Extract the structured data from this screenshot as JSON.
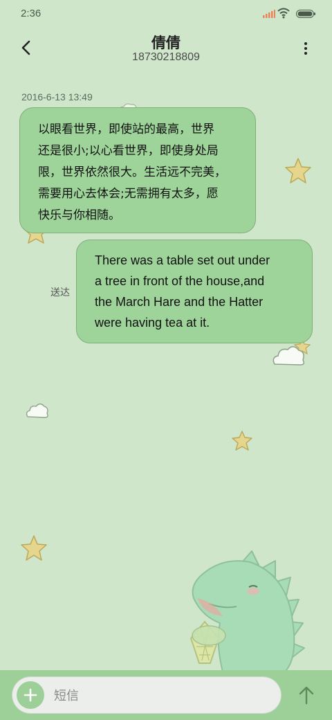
{
  "status": {
    "time": "2:36"
  },
  "header": {
    "name": "倩倩",
    "number": "18730218809"
  },
  "conversation": {
    "timestamp": "2016-6-13 13:49",
    "received": {
      "lines": [
        "以眼看世界，即使站的最高，世界",
        "还是很小;以心看世界，即使身处局",
        "限，世界依然很大。生活远不完美，",
        "需要用心去体会;无需拥有太多，愿",
        "快乐与你相随。"
      ]
    },
    "sent": {
      "lines": [
        "There was a table set out under",
        "a tree in front of the house,and",
        "the March Hare and the Hatter",
        "were having tea at it."
      ],
      "status": "送达"
    }
  },
  "composer": {
    "placeholder": "短信"
  },
  "colors": {
    "background": "#cfe6cb",
    "bubble": "#9ed49a",
    "bottom_bar": "#9dd099"
  },
  "icons": [
    "back-arrow-icon",
    "more-vertical-icon",
    "signal-icon",
    "wifi-icon",
    "battery-icon",
    "plus-icon",
    "send-arrow-icon"
  ]
}
